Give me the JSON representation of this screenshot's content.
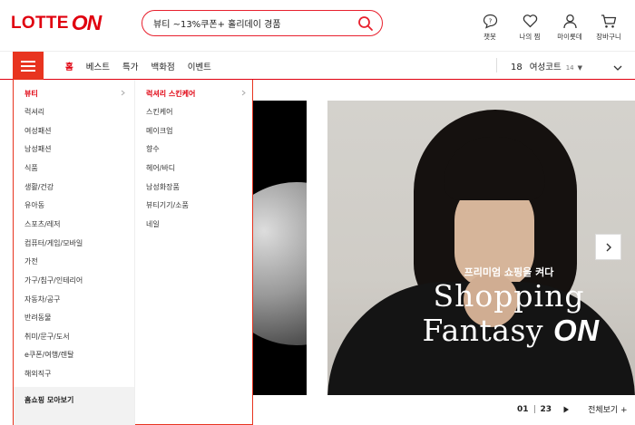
{
  "logo": {
    "text": "LOTTE",
    "accent": "ON"
  },
  "search": {
    "value": "뷰티 ~13%쿠폰+ 홀리데이 경품"
  },
  "utility": [
    {
      "label": "챗봇",
      "icon": "chatbot-icon"
    },
    {
      "label": "나의 찜",
      "icon": "heart-icon"
    },
    {
      "label": "마이롯데",
      "icon": "user-icon"
    },
    {
      "label": "장바구니",
      "icon": "cart-icon"
    }
  ],
  "gnb": {
    "tabs": [
      {
        "label": "홈",
        "active": true
      },
      {
        "label": "베스트"
      },
      {
        "label": "특가"
      },
      {
        "label": "백화점"
      },
      {
        "label": "이벤트"
      }
    ],
    "trend": {
      "rank": "18",
      "keyword": "여성코트",
      "count": "14",
      "arrow": "▼"
    }
  },
  "menu": {
    "categories": [
      "뷰티",
      "럭셔리",
      "여성패션",
      "남성패션",
      "식품",
      "생활/건강",
      "유아동",
      "스포츠/레저",
      "컴퓨터/게임/모바일",
      "가전",
      "가구/침구/인테리어",
      "자동차/공구",
      "반려동물",
      "취미/문구/도서",
      "e쿠폰/여행/렌탈",
      "해외직구"
    ],
    "active_category": "뷰티",
    "subcategories": [
      "럭셔리 스킨케어",
      "스킨케어",
      "메이크업",
      "향수",
      "헤어/바디",
      "남성화장품",
      "뷰티기기/소품",
      "네일"
    ],
    "active_subcategory": "럭셔리 스킨케어",
    "footer": "홈쇼핑 모아보기"
  },
  "banner": {
    "subtitle": "프리미엄 쇼핑을 켜다",
    "title_line1": "Shopping",
    "title_line2": "Fantasy",
    "title_on": "ON"
  },
  "pager": {
    "current": "01",
    "total": "23",
    "view_all": "전체보기 +"
  },
  "colors": {
    "brand": "#e0000f",
    "menu_button": "#e8341f"
  }
}
